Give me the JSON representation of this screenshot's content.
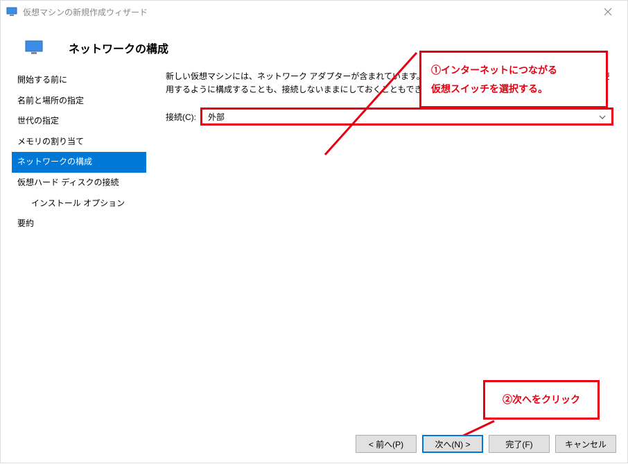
{
  "window": {
    "title": "仮想マシンの新規作成ウィザード"
  },
  "header": {
    "title": "ネットワークの構成"
  },
  "sidebar": {
    "items": [
      {
        "label": "開始する前に"
      },
      {
        "label": "名前と場所の指定"
      },
      {
        "label": "世代の指定"
      },
      {
        "label": "メモリの割り当て"
      },
      {
        "label": "ネットワークの構成",
        "selected": true
      },
      {
        "label": "仮想ハード ディスクの接続"
      },
      {
        "label": "インストール オプション",
        "indent": true
      },
      {
        "label": "要約"
      }
    ]
  },
  "main": {
    "description": "新しい仮想マシンには、ネットワーク アダプターが含まれています。そのネットワーク アダプターで仮想スイッチを使用するように構成することも、接続しないままにしておくこともできます。",
    "connection_label": "接続(C):",
    "connection_value": "外部"
  },
  "annotations": {
    "a1_line1": "①インターネットにつながる",
    "a1_line2": "仮想スイッチを選択する。",
    "a2": "②次へをクリック"
  },
  "footer": {
    "back": "< 前へ(P)",
    "next": "次へ(N) >",
    "finish": "完了(F)",
    "cancel": "キャンセル"
  }
}
